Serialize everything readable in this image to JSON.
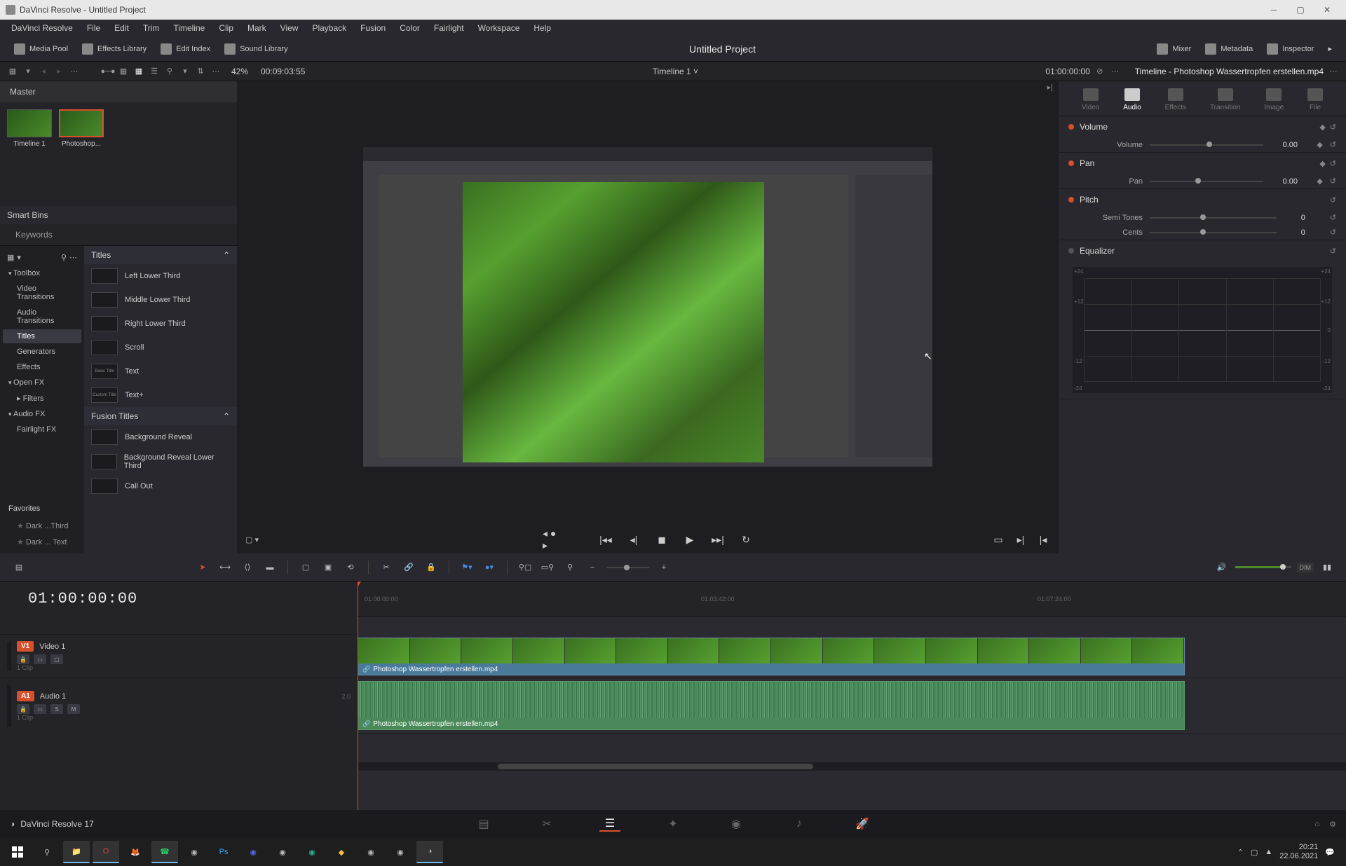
{
  "window": {
    "title": "DaVinci Resolve - Untitled Project"
  },
  "menu": [
    "DaVinci Resolve",
    "File",
    "Edit",
    "Trim",
    "Timeline",
    "Clip",
    "Mark",
    "View",
    "Playback",
    "Fusion",
    "Color",
    "Fairlight",
    "Workspace",
    "Help"
  ],
  "toolbar": {
    "media_pool": "Media Pool",
    "effects": "Effects Library",
    "edit_index": "Edit Index",
    "sound": "Sound Library",
    "mixer": "Mixer",
    "metadata": "Metadata",
    "inspector": "Inspector"
  },
  "project_title": "Untitled Project",
  "subbar": {
    "zoom": "42%",
    "timecode": "00:09:03:55",
    "timeline_name": "Timeline 1",
    "timecode_right": "01:00:00:00",
    "inspector_title": "Timeline - Photoshop Wassertropfen erstellen.mp4"
  },
  "bins": {
    "master": "Master",
    "smart": "Smart Bins",
    "keywords": "Keywords"
  },
  "clips": [
    {
      "name": "Timeline 1"
    },
    {
      "name": "Photoshop..."
    }
  ],
  "effects_tree": {
    "toolbox": "Toolbox",
    "video_trans": "Video Transitions",
    "audio_trans": "Audio Transitions",
    "titles": "Titles",
    "generators": "Generators",
    "effects": "Effects",
    "openfx": "Open FX",
    "filters": "Filters",
    "audiofx": "Audio FX",
    "fairlight": "Fairlight FX",
    "favorites": "Favorites",
    "fav1": "Dark ...Third",
    "fav2": "Dark ... Text"
  },
  "effects_list": {
    "section1": "Titles",
    "items1": [
      "Left Lower Third",
      "Middle Lower Third",
      "Right Lower Third",
      "Scroll",
      "Text",
      "Text+"
    ],
    "thumbtext": [
      "",
      "",
      "",
      "",
      "Basic Title",
      "Custom Title"
    ],
    "section2": "Fusion Titles",
    "items2": [
      "Background Reveal",
      "Background Reveal Lower Third",
      "Call Out"
    ]
  },
  "inspector_tabs": [
    "Video",
    "Audio",
    "Effects",
    "Transition",
    "Image",
    "File"
  ],
  "inspector_active": "Audio",
  "inspector_sections": {
    "volume": {
      "title": "Volume",
      "param": "Volume",
      "value": "0.00"
    },
    "pan": {
      "title": "Pan",
      "param": "Pan",
      "value": "0.00"
    },
    "pitch": {
      "title": "Pitch",
      "semi": "Semi Tones",
      "semi_val": "0",
      "cents": "Cents",
      "cents_val": "0"
    },
    "eq": {
      "title": "Equalizer"
    }
  },
  "eq_labels": {
    "p24": "+24",
    "p12": "+12",
    "zero": "0",
    "m12": "-12",
    "m24": "-24"
  },
  "timeline": {
    "timecode": "01:00:00:00",
    "ruler": [
      "01:00:00:00",
      "01:03:42:00",
      "01:07:24:00"
    ],
    "video_track": {
      "badge": "V1",
      "name": "Video 1",
      "clips": "1 Clip"
    },
    "audio_track": {
      "badge": "A1",
      "name": "Audio 1",
      "ch": "2.0",
      "clips": "1 Clip",
      "solo": "S",
      "mute": "M"
    },
    "clip_name": "Photoshop Wassertropfen erstellen.mp4"
  },
  "vol_dim": "DIM",
  "app_status": "DaVinci Resolve 17",
  "tray": {
    "time": "20:21",
    "date": "22.06.2021"
  }
}
